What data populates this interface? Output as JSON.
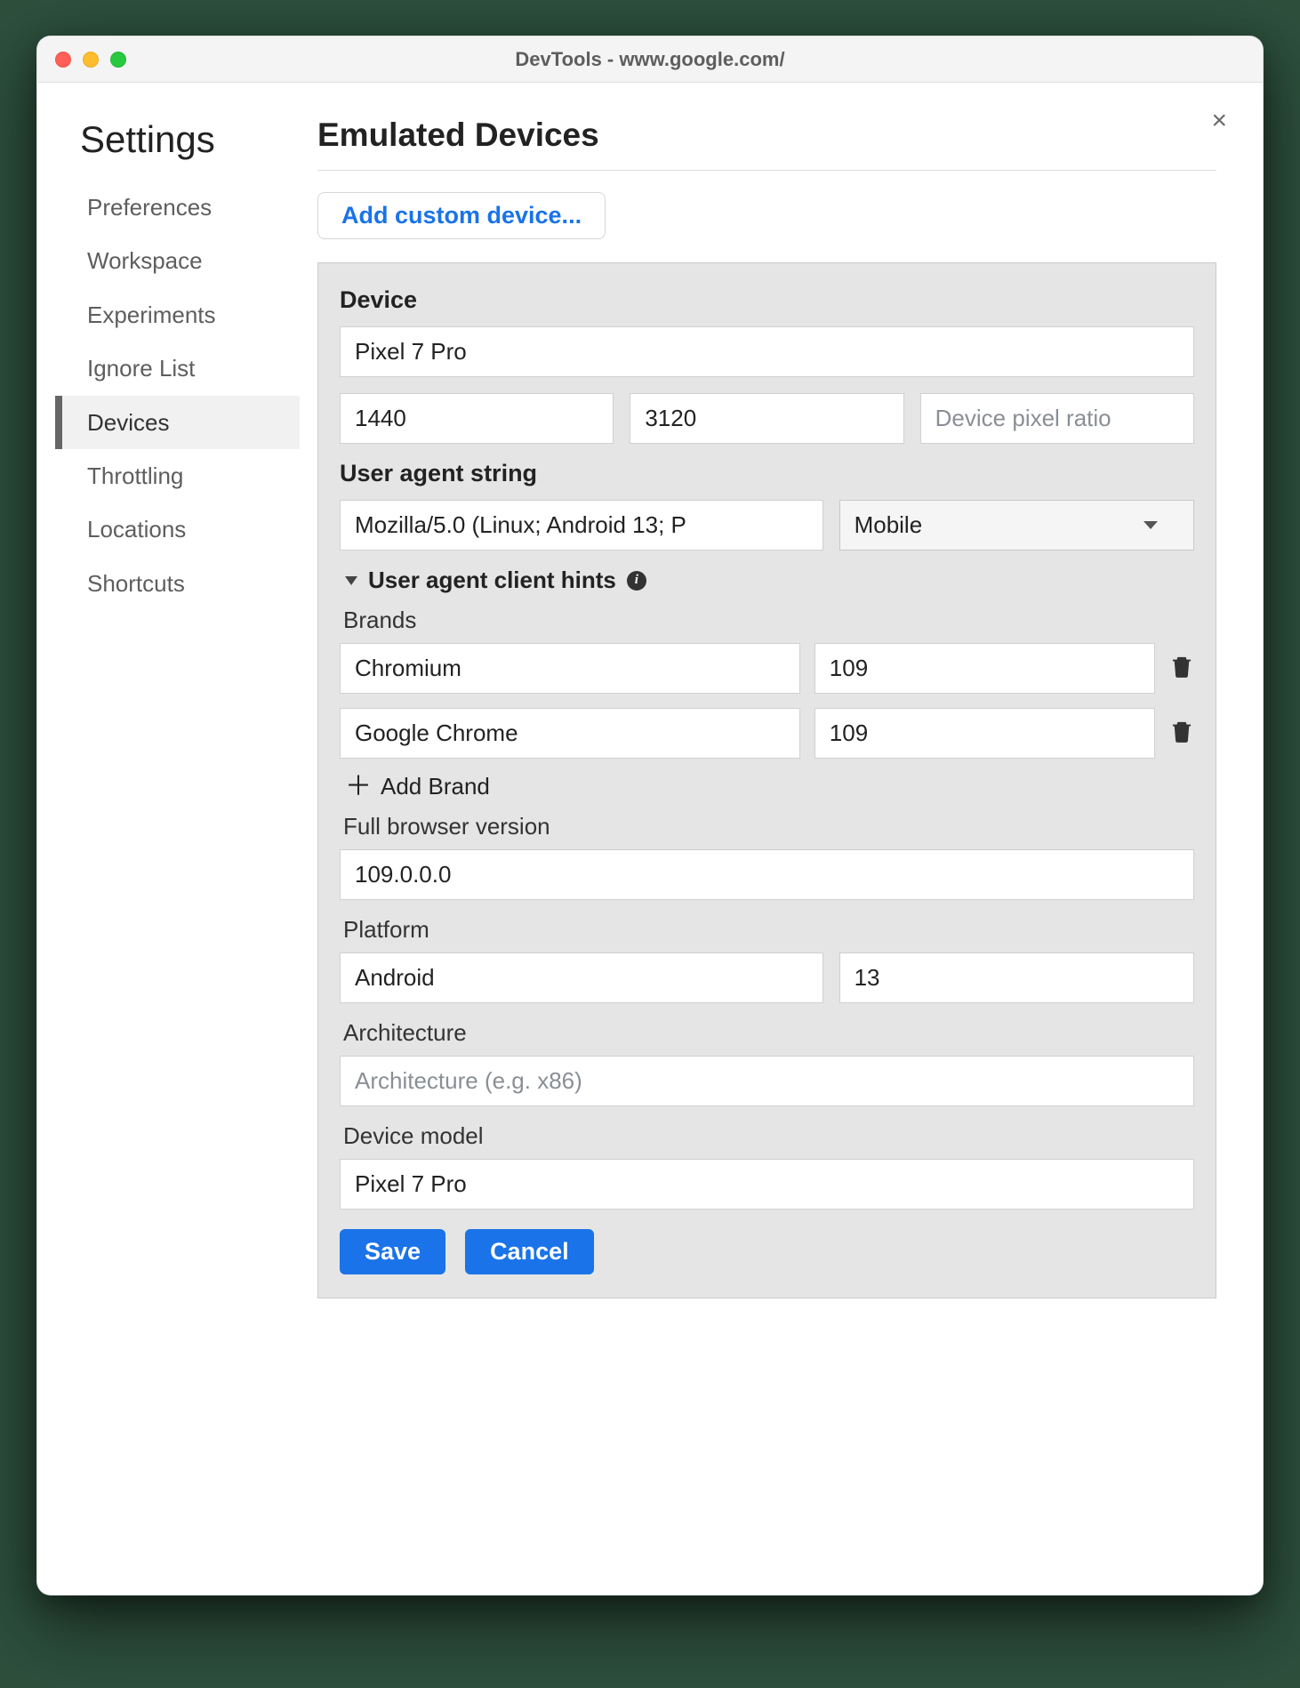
{
  "window": {
    "title": "DevTools - www.google.com/"
  },
  "sidebar": {
    "heading": "Settings",
    "items": [
      {
        "label": "Preferences"
      },
      {
        "label": "Workspace"
      },
      {
        "label": "Experiments"
      },
      {
        "label": "Ignore List"
      },
      {
        "label": "Devices"
      },
      {
        "label": "Throttling"
      },
      {
        "label": "Locations"
      },
      {
        "label": "Shortcuts"
      }
    ],
    "active_index": 4
  },
  "main": {
    "heading": "Emulated Devices",
    "add_button": "Add custom device...",
    "close_label": "×"
  },
  "device": {
    "section_label": "Device",
    "name": "Pixel 7 Pro",
    "width": "1440",
    "height": "3120",
    "dpr_placeholder": "Device pixel ratio",
    "ua_label": "User agent string",
    "ua_value": "Mozilla/5.0 (Linux; Android 13; P",
    "ua_type": "Mobile",
    "hints": {
      "header": "User agent client hints",
      "brands_label": "Brands",
      "brands": [
        {
          "name": "Chromium",
          "version": "109"
        },
        {
          "name": "Google Chrome",
          "version": "109"
        }
      ],
      "add_brand": "Add Brand",
      "full_version_label": "Full browser version",
      "full_version": "109.0.0.0",
      "platform_label": "Platform",
      "platform": "Android",
      "platform_version": "13",
      "architecture_label": "Architecture",
      "architecture_placeholder": "Architecture (e.g. x86)",
      "device_model_label": "Device model",
      "device_model": "Pixel 7 Pro"
    },
    "save": "Save",
    "cancel": "Cancel"
  }
}
